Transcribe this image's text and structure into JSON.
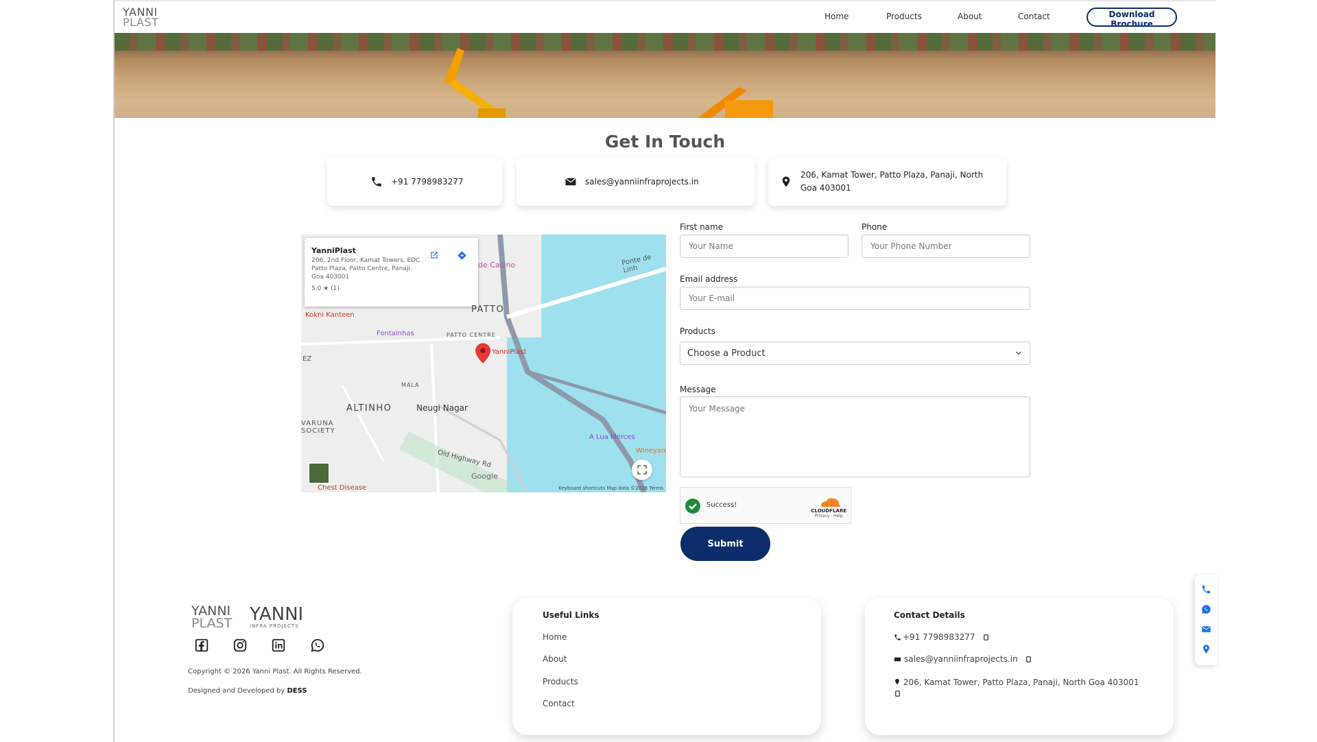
{
  "nav": {
    "logo_line1": "YANNI",
    "logo_line2": "PLAST",
    "items": [
      "Home",
      "Products",
      "About",
      "Contact"
    ],
    "brochure_label": "Download Brochure"
  },
  "page_title": "Get In Touch",
  "contact_cards": {
    "phone": "+91 7798983277",
    "email": "sales@yanniinfraprojects.in",
    "address": "206, Kamat Tower, Patto Plaza, Panaji, North Goa 403001"
  },
  "map": {
    "place_name": "YanniPlast",
    "place_address": "206, 2nd Floor, Kamat Towers, EDC Patto Plaza, Patto Centre, Panaji, Goa 403001",
    "rating": "5.0 ★ (1)",
    "labels": {
      "casino": "de Casino",
      "ponte": "Ponte de Linh",
      "patto": "PATTO",
      "kokni": "Kokni Kanteen",
      "fontainhas": "Fontainhas",
      "patto_centre": "PATTO CENTRE",
      "yanniplast": "YanniPlast",
      "ez": "EZ",
      "mala": "MALA",
      "altinho": "ALTINHO",
      "neugi": "Neugi Nagar",
      "varuna": "VARUNA",
      "society": "SOCIETY",
      "old_highway": "Old Highway Rd",
      "lua": "A Lua Merces",
      "wineyard": "Wineyard",
      "chest": "Chest Disease",
      "google": "Google",
      "footer": "Keyboard shortcuts    Map data ©2026    Terms"
    }
  },
  "form": {
    "first_name_label": "First name",
    "first_name_placeholder": "Your Name",
    "phone_label": "Phone",
    "phone_placeholder": "Your Phone Number",
    "email_label": "Email address",
    "email_placeholder": "Your E-mail",
    "products_label": "Products",
    "products_selected": "Choose a Product",
    "message_label": "Message",
    "message_placeholder": "Your Message",
    "captcha_status": "Success!",
    "captcha_brand": "CLOUDFLARE",
    "captcha_links": "Privacy · Help",
    "submit_label": "Submit"
  },
  "footer": {
    "logo1_line1": "YANNI",
    "logo1_line2": "PLAST",
    "logo2_line1": "YANNI",
    "logo2_line2": "INFRA PROJECTS",
    "copyright": "Copyright © 2026 Yanni Plast. All Rights Reserved.",
    "designed_prefix": "Designed and Developed by ",
    "designed_by": "DESS",
    "useful_links_title": "Useful Links",
    "useful_links": [
      "Home",
      "About",
      "Products",
      "Contact"
    ],
    "contact_title": "Contact Details",
    "contact_phone": "+91 7798983277",
    "contact_email": "sales@yanniinfraprojects.in",
    "contact_address": "206, Kamat Tower, Patto Plaza, Panaji, North Goa 403001"
  },
  "colors": {
    "brand_navy": "#0c2c6b",
    "icon_blue": "#1a73e8"
  }
}
